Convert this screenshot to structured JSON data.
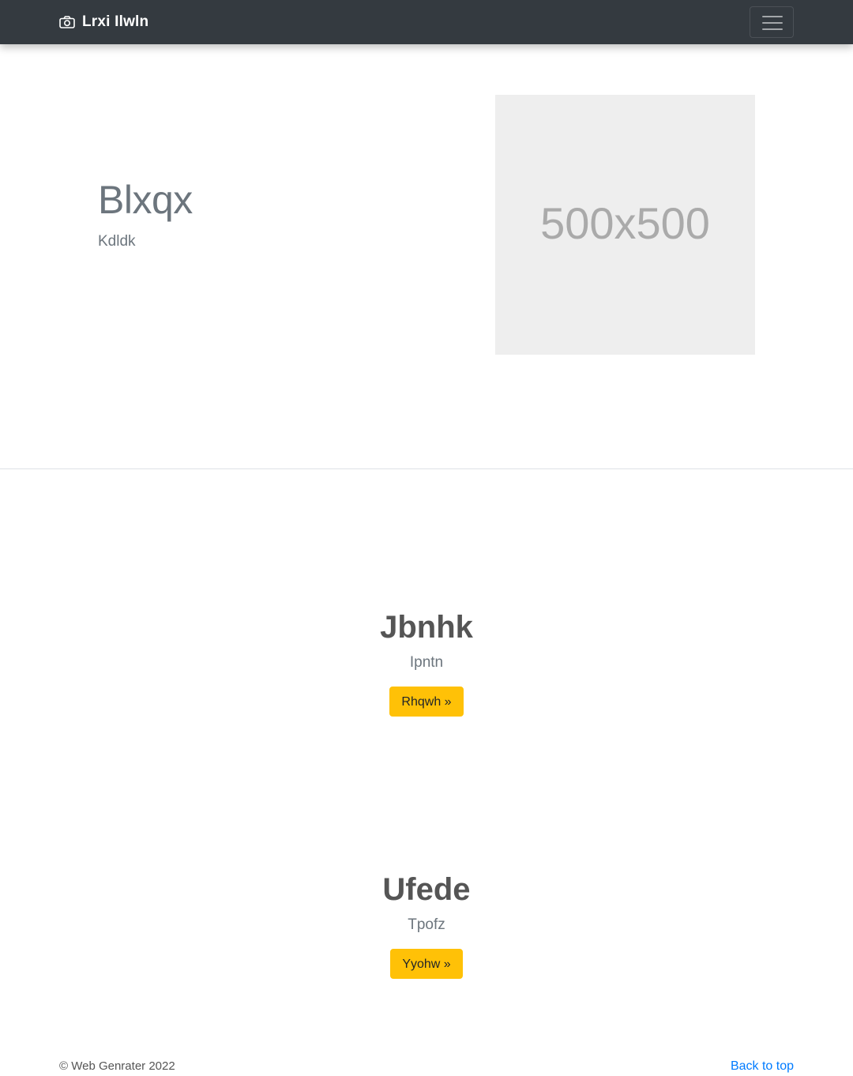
{
  "navbar": {
    "brand_icon": "camera-icon",
    "brand_text": "Lrxi Ilwln",
    "toggler_icon": "hamburger-menu-icon",
    "background": "#343a40"
  },
  "hero": {
    "title": "Blxqx",
    "subtitle": "Kdldk",
    "image_placeholder": "500x500"
  },
  "features": [
    {
      "title": "Jbnhk",
      "text": "Ipntn",
      "button_label": "Rhqwh »"
    },
    {
      "title": "Ufede",
      "text": "Tpofz",
      "button_label": "Yyohw »"
    }
  ],
  "footer": {
    "copyright": "© Web Genrater 2022",
    "back_to_top": "Back to top"
  },
  "colors": {
    "button": "#ffc107",
    "link": "#007bff"
  }
}
